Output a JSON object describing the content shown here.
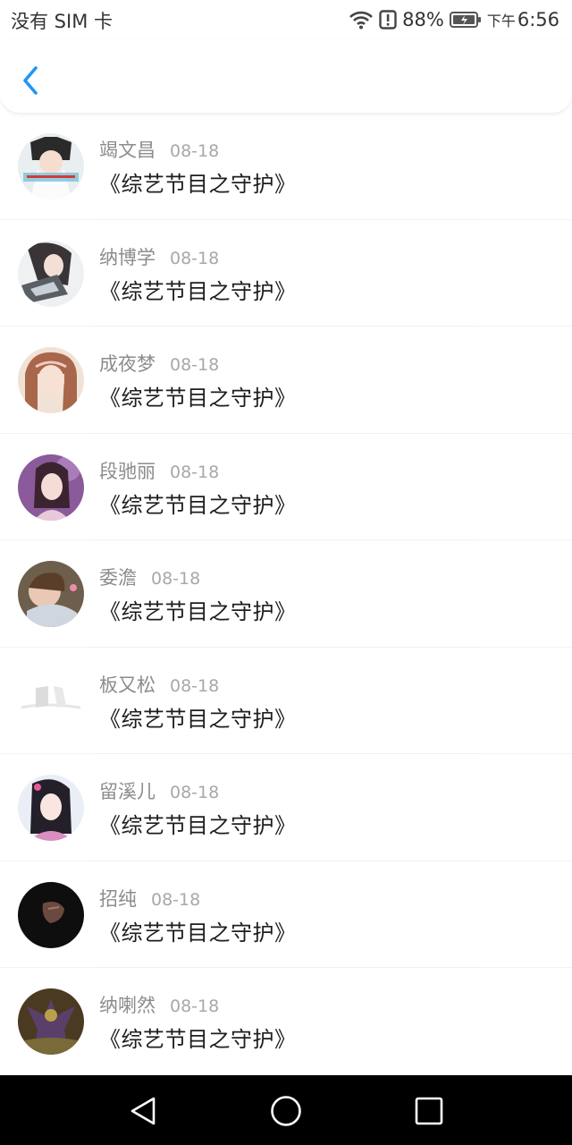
{
  "status_bar": {
    "carrier": "没有 SIM 卡",
    "battery_percent": "88%",
    "ampm": "下午",
    "time": "6:56",
    "icons": [
      "wifi-icon",
      "alert-icon",
      "battery-icon"
    ]
  },
  "header": {
    "back_icon": "chevron-left-icon",
    "accent_color": "#2196F3"
  },
  "items": [
    {
      "name": "竭文昌",
      "date": "08-18",
      "title": "《综艺节目之守护》"
    },
    {
      "name": "纳博学",
      "date": "08-18",
      "title": "《综艺节目之守护》"
    },
    {
      "name": "成夜梦",
      "date": "08-18",
      "title": "《综艺节目之守护》"
    },
    {
      "name": "段驰丽",
      "date": "08-18",
      "title": "《综艺节目之守护》"
    },
    {
      "name": "委澹",
      "date": "08-18",
      "title": "《综艺节目之守护》"
    },
    {
      "name": "板又松",
      "date": "08-18",
      "title": "《综艺节目之守护》"
    },
    {
      "name": "留溪儿",
      "date": "08-18",
      "title": "《综艺节目之守护》"
    },
    {
      "name": "招纯",
      "date": "08-18",
      "title": "《综艺节目之守护》"
    },
    {
      "name": "纳喇然",
      "date": "08-18",
      "title": "《综艺节目之守护》"
    }
  ],
  "nav_bar": {
    "icons": [
      "back-triangle-icon",
      "home-circle-icon",
      "recents-square-icon"
    ]
  }
}
